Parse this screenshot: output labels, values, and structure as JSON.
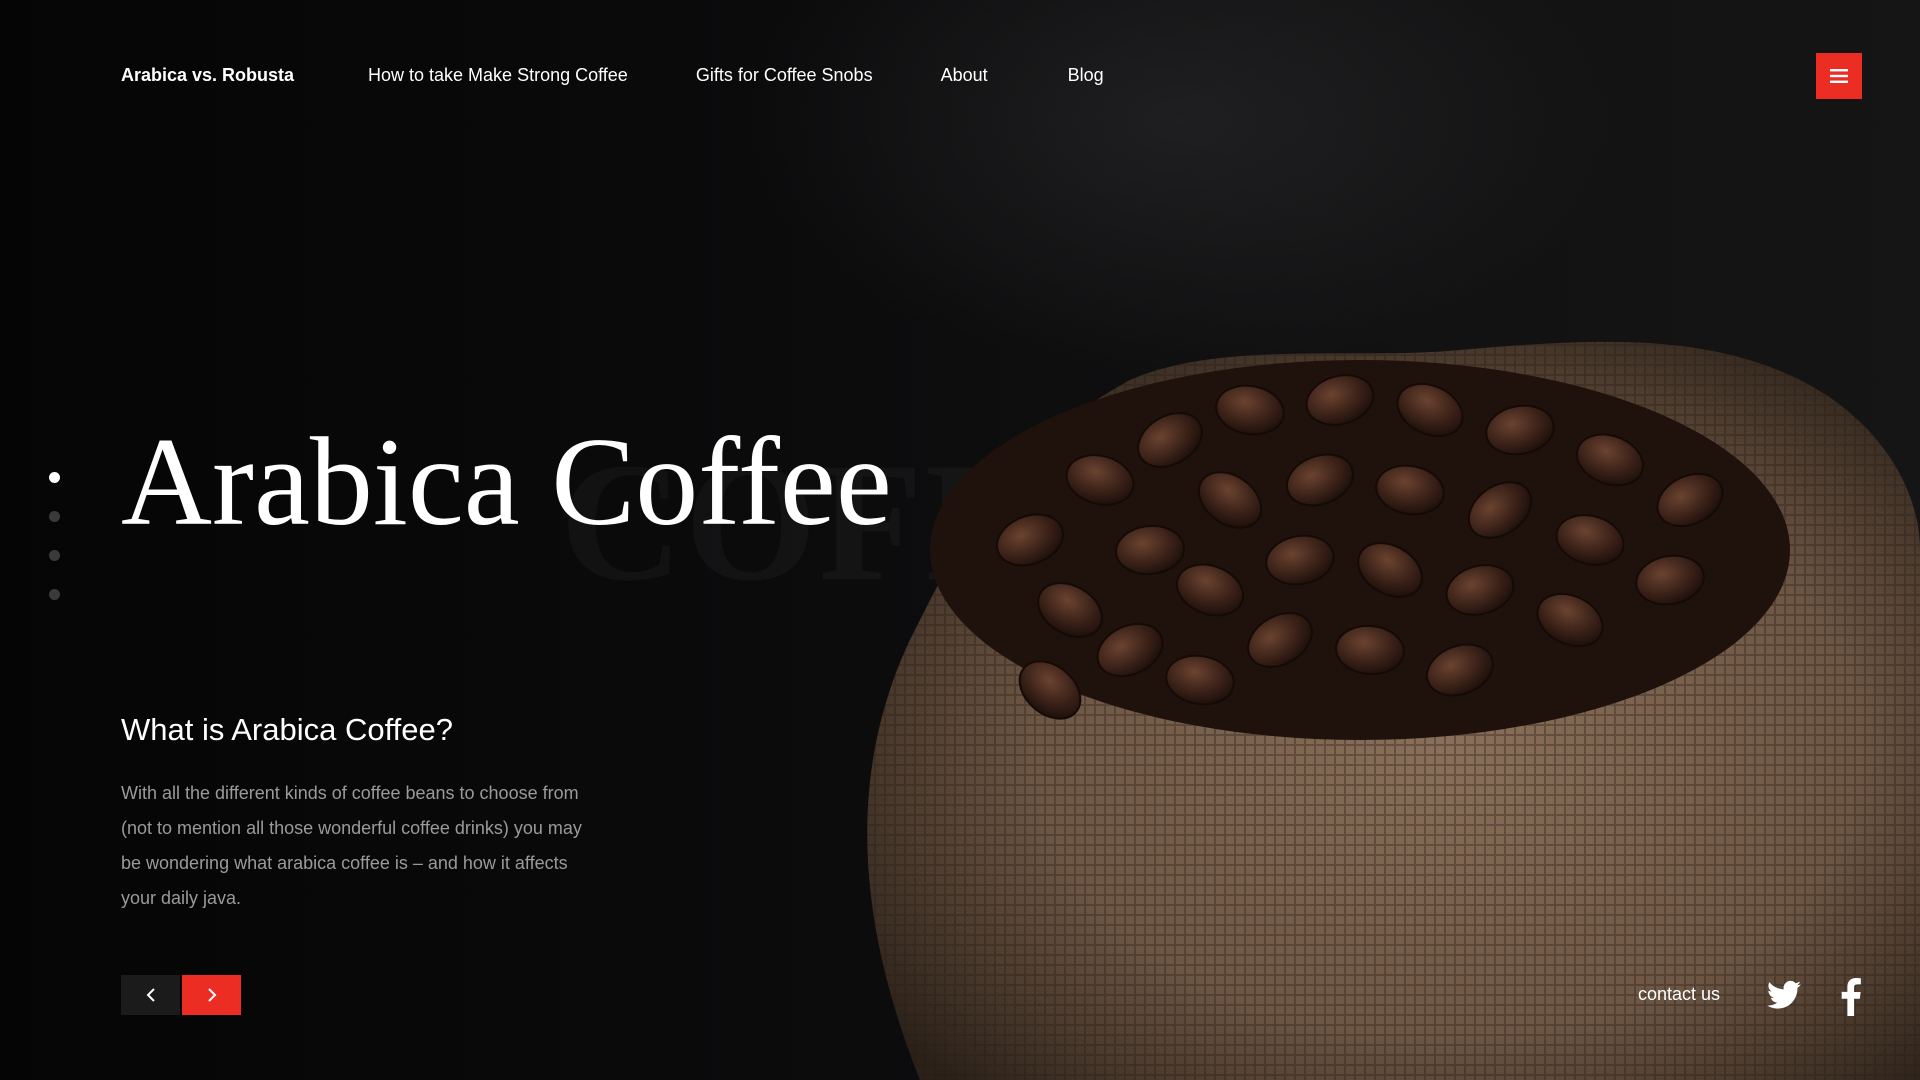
{
  "header": {
    "brand": "Arabica vs. Robusta",
    "nav": [
      "How to take Make Strong Coffee",
      "Gifts for Coffee Snobs",
      "About",
      "Blog"
    ],
    "menu_icon": "hamburger-icon"
  },
  "hero": {
    "title": "Arabica Coffee",
    "subtitle": "What is Arabica Coffee?",
    "description": "With all the different kinds of coffee beans to choose from (not to mention all those wonderful coffee drinks) you may be wondering what arabica coffee is – and how it affects your daily java.",
    "background_image": "coffee-beans-in-burlap-sack"
  },
  "slider": {
    "slide_count": 4,
    "active_slide": 1,
    "prev_icon": "chevron-left-icon",
    "next_icon": "chevron-right-icon"
  },
  "footer": {
    "contact_label": "contact us",
    "social": [
      "twitter-icon",
      "facebook-icon"
    ]
  },
  "colors": {
    "accent": "#ec2d24",
    "background": "#080808",
    "text": "#ffffff",
    "muted_text": "#9a9a9a"
  }
}
